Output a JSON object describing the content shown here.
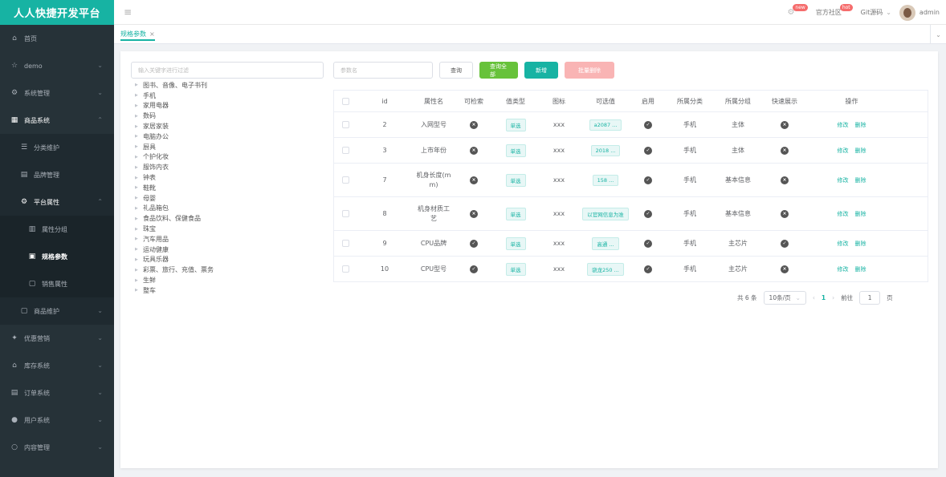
{
  "app": {
    "title": "人人快捷开发平台"
  },
  "sidebar": {
    "items": [
      {
        "label": "首页",
        "icon": "home-icon"
      },
      {
        "label": "demo",
        "icon": "star-icon"
      },
      {
        "label": "系统管理",
        "icon": "gear-icon"
      },
      {
        "label": "商品系统",
        "icon": "grid-icon"
      },
      {
        "label": "分类维护",
        "icon": "list-icon"
      },
      {
        "label": "品牌管理",
        "icon": "brand-icon"
      },
      {
        "label": "平台属性",
        "icon": "settings-icon"
      },
      {
        "label": "属性分组",
        "icon": "chart-icon"
      },
      {
        "label": "规格参数",
        "icon": "doc-icon"
      },
      {
        "label": "销售属性",
        "icon": "box-icon"
      },
      {
        "label": "商品维护",
        "icon": "box-icon"
      },
      {
        "label": "优惠营销",
        "icon": "tag-icon"
      },
      {
        "label": "库存系统",
        "icon": "warehouse-icon"
      },
      {
        "label": "订单系统",
        "icon": "order-icon"
      },
      {
        "label": "用户系统",
        "icon": "user-icon"
      },
      {
        "label": "内容管理",
        "icon": "search-icon"
      }
    ]
  },
  "topbar": {
    "new_badge": "new",
    "community": "官方社区",
    "hot_badge": "hot",
    "git": "Git源码",
    "user": "admin"
  },
  "tabs": {
    "active": "规格参数"
  },
  "tree": {
    "filter_placeholder": "输入关键字进行过滤",
    "nodes": [
      "图书、音像、电子书刊",
      "手机",
      "家用电器",
      "数码",
      "家居家装",
      "电脑办公",
      "厨具",
      "个护化妆",
      "服饰内衣",
      "钟表",
      "鞋靴",
      "母婴",
      "礼品箱包",
      "食品饮料、保健食品",
      "珠宝",
      "汽车用品",
      "运动健康",
      "玩具乐器",
      "彩票、旅行、充值、票务",
      "生鲜",
      "整车"
    ]
  },
  "search": {
    "param_placeholder": "参数名",
    "query": "查询",
    "query_all": "查询全部",
    "add": "新增",
    "batch_delete": "批量删除"
  },
  "table": {
    "headers": [
      "id",
      "属性名",
      "可检索",
      "值类型",
      "图标",
      "可选值",
      "启用",
      "所属分类",
      "所属分组",
      "快速展示",
      "操作"
    ],
    "edit": "修改",
    "delete": "删除",
    "rows": [
      {
        "id": "2",
        "name": "入网型号",
        "searchable": false,
        "type": "单选",
        "icon": "xxx",
        "values": "a2087 ...",
        "enabled": true,
        "category": "手机",
        "group": "主体",
        "quick": false
      },
      {
        "id": "3",
        "name": "上市年份",
        "searchable": false,
        "type": "单选",
        "icon": "xxx",
        "values": "2018 ...",
        "enabled": true,
        "category": "手机",
        "group": "主体",
        "quick": false
      },
      {
        "id": "7",
        "name": "机身长度(mm)",
        "searchable": false,
        "type": "单选",
        "icon": "xxx",
        "values": "158 ...",
        "enabled": true,
        "category": "手机",
        "group": "基本信息",
        "quick": false
      },
      {
        "id": "8",
        "name": "机身材质工艺",
        "searchable": false,
        "type": "单选",
        "icon": "xxx",
        "values": "以官网信息为准",
        "enabled": true,
        "category": "手机",
        "group": "基本信息",
        "quick": false
      },
      {
        "id": "9",
        "name": "CPU品牌",
        "searchable": true,
        "type": "单选",
        "icon": "xxx",
        "values": "高通 ...",
        "enabled": true,
        "category": "手机",
        "group": "主芯片",
        "quick": true
      },
      {
        "id": "10",
        "name": "CPU型号",
        "searchable": true,
        "type": "单选",
        "icon": "xxx",
        "values": "骁龙250 ...",
        "enabled": true,
        "category": "手机",
        "group": "主芯片",
        "quick": false
      }
    ]
  },
  "pager": {
    "total": "共 6 条",
    "page_size": "10条/页",
    "current": "1",
    "goto": "前往",
    "goto_value": "1",
    "page_suffix": "页"
  },
  "colors": {
    "brand": "#17b3a3",
    "sidebar": "#263238",
    "success": "#67c23a",
    "danger": "#f9b4b4"
  }
}
